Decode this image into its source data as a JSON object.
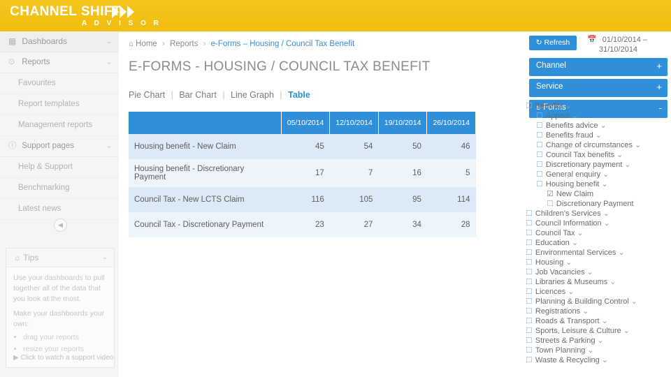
{
  "header": {
    "brand_part1": "CHANNEL",
    "brand_part2": "SHIFT",
    "subtitle": "A D V I S O R",
    "chevron_icon": "chevron-right-icon"
  },
  "sidebar": {
    "groups": [
      {
        "label": "Dashboards",
        "icon": "dashboard-icon",
        "caret": "⌄"
      },
      {
        "label": "Reports",
        "icon": "bar-chart-icon",
        "caret": "⌄"
      }
    ],
    "reports_items": [
      "Favourites",
      "Report templates",
      "Management reports"
    ],
    "support_group": {
      "label": "Support pages",
      "icon": "info-icon",
      "caret": "⌄"
    },
    "support_items": [
      "Help & Support",
      "Benchmarking",
      "Latest news"
    ],
    "collapse_icon": "chevron-left-icon",
    "tips": {
      "title": "Tips",
      "title_icon": "lightbulb-icon",
      "line1": "Use your dashboards to pull together all of the data that you look at the most.",
      "line2": "Make your dashboards your own:",
      "bullets": [
        "drag your reports",
        "resize your reports"
      ],
      "link": "Click to watch a support video",
      "link_icon": "video-icon",
      "caret": "⌄"
    }
  },
  "main": {
    "breadcrumb": {
      "home_icon": "home-icon",
      "home": "Home",
      "reports": "Reports",
      "current": "e-Forms – Housing / Council Tax Benefit",
      "separator": "›"
    },
    "page_title": "E-FORMS - HOUSING / COUNCIL TAX BENEFIT",
    "view_tabs": [
      {
        "label": "Pie Chart",
        "active": false
      },
      {
        "label": "Bar Chart",
        "active": false
      },
      {
        "label": "Line Graph",
        "active": false
      },
      {
        "label": "Table",
        "active": true
      }
    ]
  },
  "chart_data": {
    "type": "table",
    "title": "E-FORMS - HOUSING / COUNCIL TAX BENEFIT",
    "columns": [
      "",
      "05/10/2014",
      "12/10/2014",
      "19/10/2014",
      "26/10/2014"
    ],
    "categories": [
      "Housing benefit - New Claim",
      "Housing benefit - Discretionary Payment",
      "Council Tax - New LCTS Claim",
      "Council Tax - Discretionary Payment"
    ],
    "x": [
      "05/10/2014",
      "12/10/2014",
      "19/10/2014",
      "26/10/2014"
    ],
    "series": [
      {
        "name": "Housing benefit - New Claim",
        "values": [
          45,
          54,
          50,
          46
        ]
      },
      {
        "name": "Housing benefit - Discretionary Payment",
        "values": [
          17,
          7,
          16,
          5
        ]
      },
      {
        "name": "Council Tax - New LCTS Claim",
        "values": [
          116,
          105,
          95,
          114
        ]
      },
      {
        "name": "Council Tax - Discretionary Payment",
        "values": [
          23,
          27,
          34,
          28
        ]
      }
    ],
    "xlabel": "",
    "ylabel": "",
    "legend": "none",
    "grid": false
  },
  "right": {
    "refresh_label": "Refresh",
    "refresh_icon": "refresh-icon",
    "calendar_icon": "calendar-icon",
    "date_range_line1": "01/10/2014 –",
    "date_range_line2": "31/10/2014",
    "accordions": [
      {
        "label": "Channel",
        "sign": "+"
      },
      {
        "label": "Service",
        "sign": "+"
      },
      {
        "label": "e-Forms",
        "sign": "-"
      }
    ],
    "tree": [
      {
        "level": 1,
        "label": "Benefits",
        "caret": "⌄",
        "checkbox": "unchecked"
      },
      {
        "level": 2,
        "label": "Appeal",
        "caret": "⌄",
        "checkbox": "unchecked"
      },
      {
        "level": 2,
        "label": "Benefits advice",
        "caret": "⌄",
        "checkbox": "unchecked"
      },
      {
        "level": 2,
        "label": "Benefits fraud",
        "caret": "⌄",
        "checkbox": "unchecked"
      },
      {
        "level": 2,
        "label": "Change of circumstances",
        "caret": "⌄",
        "checkbox": "unchecked"
      },
      {
        "level": 2,
        "label": "Council Tax benefits",
        "caret": "⌄",
        "checkbox": "unchecked"
      },
      {
        "level": 2,
        "label": "Discretionary payment",
        "caret": "⌄",
        "checkbox": "unchecked"
      },
      {
        "level": 2,
        "label": "General enquiry",
        "caret": "⌄",
        "checkbox": "unchecked"
      },
      {
        "level": 2,
        "label": "Housing benefit",
        "caret": "⌄",
        "checkbox": "unchecked"
      },
      {
        "level": 3,
        "label": "New Claim",
        "caret": "",
        "checkbox": "checked"
      },
      {
        "level": 3,
        "label": "Discretionary Payment",
        "caret": "",
        "checkbox": "unchecked"
      },
      {
        "level": 1,
        "label": "Children's Services",
        "caret": "⌄",
        "checkbox": "unchecked"
      },
      {
        "level": 1,
        "label": "Council Information",
        "caret": "⌄",
        "checkbox": "unchecked"
      },
      {
        "level": 1,
        "label": "Council Tax",
        "caret": "⌄",
        "checkbox": "unchecked"
      },
      {
        "level": 1,
        "label": "Education",
        "caret": "⌄",
        "checkbox": "unchecked"
      },
      {
        "level": 1,
        "label": "Environmental Services",
        "caret": "⌄",
        "checkbox": "unchecked"
      },
      {
        "level": 1,
        "label": "Housing",
        "caret": "⌄",
        "checkbox": "unchecked"
      },
      {
        "level": 1,
        "label": "Job Vacancies",
        "caret": "⌄",
        "checkbox": "unchecked"
      },
      {
        "level": 1,
        "label": "Libraries & Museums",
        "caret": "⌄",
        "checkbox": "unchecked"
      },
      {
        "level": 1,
        "label": "Licences",
        "caret": "⌄",
        "checkbox": "unchecked"
      },
      {
        "level": 1,
        "label": "Planning & Building Control",
        "caret": "⌄",
        "checkbox": "unchecked"
      },
      {
        "level": 1,
        "label": "Registrations",
        "caret": "⌄",
        "checkbox": "unchecked"
      },
      {
        "level": 1,
        "label": "Roads & Transport",
        "caret": "⌄",
        "checkbox": "unchecked"
      },
      {
        "level": 1,
        "label": "Sports, Leisure & Culture",
        "caret": "⌄",
        "checkbox": "unchecked"
      },
      {
        "level": 1,
        "label": "Streets & Parking",
        "caret": "⌄",
        "checkbox": "unchecked"
      },
      {
        "level": 1,
        "label": "Town Planning",
        "caret": "⌄",
        "checkbox": "unchecked"
      },
      {
        "level": 1,
        "label": "Waste & Recycling",
        "caret": "⌄",
        "checkbox": "unchecked"
      }
    ]
  },
  "colors": {
    "brand_yellow": "#f2c00e",
    "accent_blue": "#2f8fd8",
    "row_dark": "#dce9f6",
    "row_light": "#eef4fb"
  }
}
